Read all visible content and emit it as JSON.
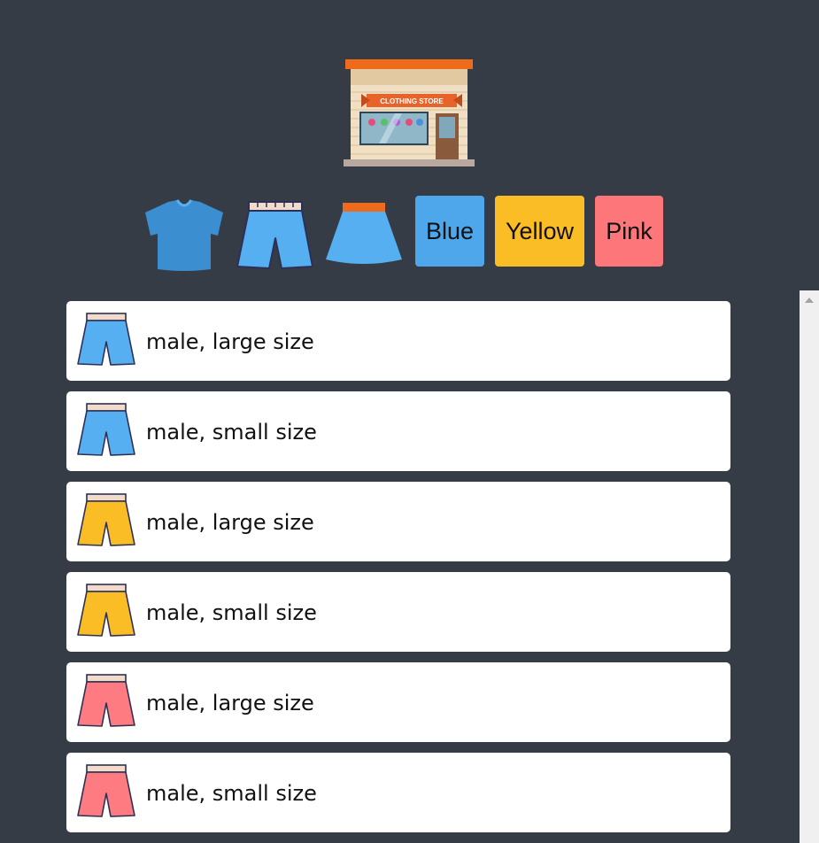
{
  "store": {
    "sign_text": "CLOTHING STORE"
  },
  "filters": {
    "categories": [
      {
        "name": "t-shirt-icon",
        "color": "#3b8fd0"
      },
      {
        "name": "shorts-icon",
        "color": "#55aff0"
      },
      {
        "name": "skirt-icon",
        "color": "#55aff0"
      }
    ],
    "colors": [
      {
        "label": "Blue",
        "color": "#4ea7ea"
      },
      {
        "label": "Yellow",
        "color": "#fbbd26"
      },
      {
        "label": "Pink",
        "color": "#fd767a"
      }
    ]
  },
  "items": [
    {
      "label": "male, large size",
      "icon": "shorts-icon",
      "color": "#55aff0"
    },
    {
      "label": "male, small size",
      "icon": "shorts-icon",
      "color": "#55aff0"
    },
    {
      "label": "male, large size",
      "icon": "shorts-icon",
      "color": "#fbbd26"
    },
    {
      "label": "male, small size",
      "icon": "shorts-icon",
      "color": "#fbbd26"
    },
    {
      "label": "male, large size",
      "icon": "shorts-icon",
      "color": "#fd7b81"
    },
    {
      "label": "male, small size",
      "icon": "shorts-icon",
      "color": "#fd7b81"
    }
  ]
}
